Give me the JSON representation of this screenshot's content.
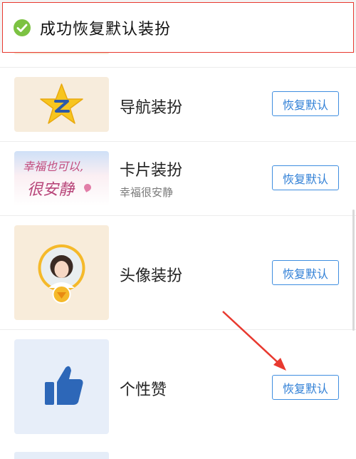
{
  "toast": {
    "icon": "check-circle-icon",
    "text": "成功恢复默认装扮",
    "accent": "#7cc242",
    "border_color": "#e8392f"
  },
  "items": [
    {
      "title": "导航装扮",
      "subtitle": "",
      "button_label": "恢复默认",
      "thumb_icon": "qq-star-z-icon"
    },
    {
      "title": "卡片装扮",
      "subtitle": "幸福很安静",
      "button_label": "恢复默认",
      "thumb_text_line1": "幸福也可以,",
      "thumb_text_line2": "很安静",
      "thumb_icon": "card-art-thumbnail"
    },
    {
      "title": "头像装扮",
      "subtitle": "",
      "button_label": "恢复默认",
      "thumb_icon": "avatar-with-badge-icon"
    },
    {
      "title": "个性赞",
      "subtitle": "",
      "button_label": "恢复默认",
      "thumb_icon": "thumbs-up-icon"
    }
  ],
  "colors": {
    "button_blue": "#3f8ee0",
    "annotation_red": "#e8392f"
  }
}
